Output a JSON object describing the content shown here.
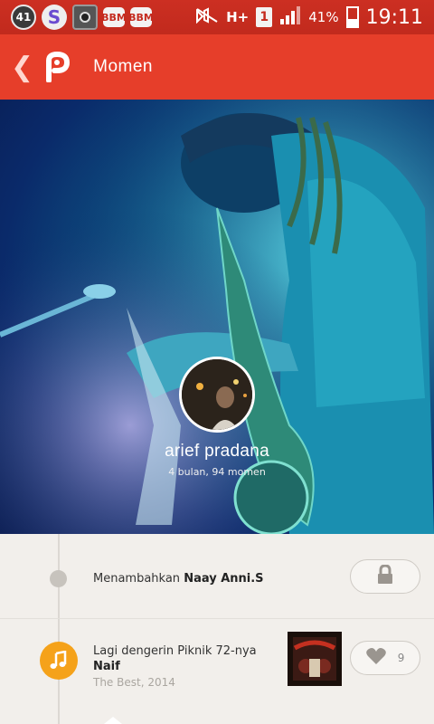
{
  "status_bar": {
    "notification_count": "41",
    "s_icon_letter": "S",
    "bbm_label": "BBM",
    "network": "H+",
    "sim_slot": "1",
    "battery": "41%",
    "time": "19:11"
  },
  "app_bar": {
    "back_glyph": "❮",
    "title": "Momen"
  },
  "profile": {
    "name": "arief pradana",
    "stats": "4 bulan, 94 momen"
  },
  "feed": {
    "items": [
      {
        "prefix": "Menambahkan ",
        "highlight": "Naay Anni.S"
      },
      {
        "line1": "Lagi dengerin Piknik 72-nya",
        "artist": "Naif",
        "album_info": "The Best, 2014",
        "like_count": "9"
      }
    ]
  },
  "colors": {
    "status_bar": "#c42b1f",
    "app_bar": "#e63e2a",
    "music_badge": "#f5a21a",
    "feed_background": "#f2efeb"
  },
  "icons": {
    "app_logo": "path-logo-icon",
    "lock": "lock-icon",
    "heart": "heart-icon",
    "music": "music-note-icon"
  }
}
